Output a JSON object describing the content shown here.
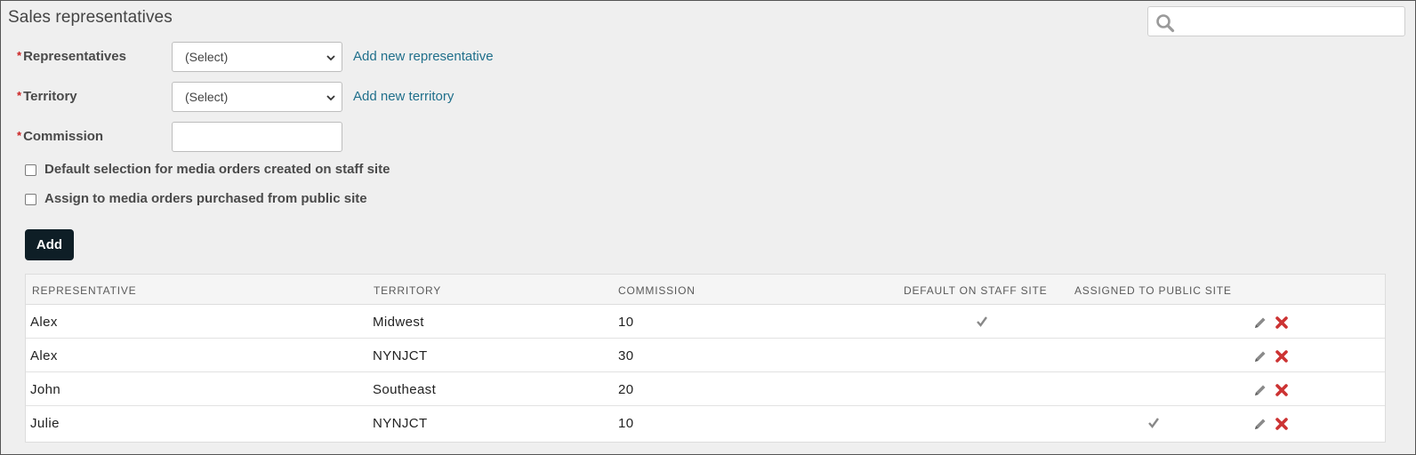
{
  "page": {
    "title": "Sales representatives"
  },
  "search": {
    "value": "",
    "placeholder": ""
  },
  "form": {
    "required_marker": "*",
    "representatives": {
      "label": "Representatives",
      "selected": "(Select)",
      "link": "Add new representative"
    },
    "territory": {
      "label": "Territory",
      "selected": "(Select)",
      "link": "Add new territory"
    },
    "commission": {
      "label": "Commission",
      "value": ""
    },
    "default_staff": {
      "label": "Default selection for media orders created on staff site",
      "checked": false
    },
    "assign_public": {
      "label": "Assign to media orders purchased from public site",
      "checked": false
    },
    "add_label": "Add"
  },
  "table": {
    "columns": [
      "REPRESENTATIVE",
      "TERRITORY",
      "COMMISSION",
      "DEFAULT ON STAFF SITE",
      "ASSIGNED TO PUBLIC SITE"
    ],
    "rows": [
      {
        "representative": "Alex",
        "territory": "Midwest",
        "commission": "10",
        "default_staff": true,
        "assigned_public": false
      },
      {
        "representative": "Alex",
        "territory": "NYNJCT",
        "commission": "30",
        "default_staff": false,
        "assigned_public": false
      },
      {
        "representative": "John",
        "territory": "Southeast",
        "commission": "20",
        "default_staff": false,
        "assigned_public": false
      },
      {
        "representative": "Julie",
        "territory": "NYNJCT",
        "commission": "10",
        "default_staff": false,
        "assigned_public": true
      }
    ]
  },
  "icons": {
    "search": "search-icon",
    "edit": "pencil-icon",
    "delete": "close-icon",
    "check": "checkmark-icon"
  },
  "colors": {
    "link": "#1f6f8b",
    "button": "#0e1e26",
    "delete": "#cc3333",
    "required": "#cc2222"
  }
}
